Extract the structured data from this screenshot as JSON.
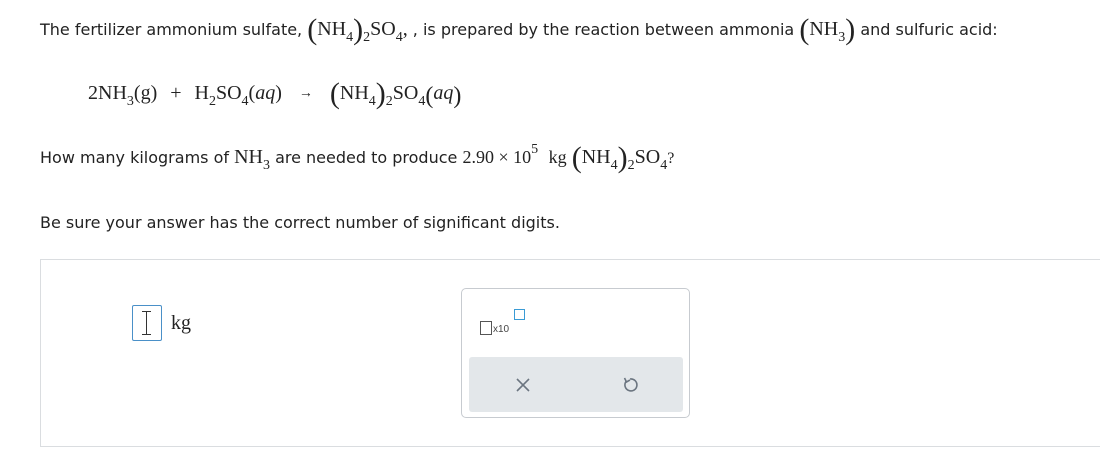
{
  "problem": {
    "intro_before": "The fertilizer ammonium sulfate,",
    "intro_middle": ", is prepared by the reaction between ammonia",
    "intro_after": "and sulfuric acid:",
    "question_before": "How many kilograms of",
    "question_middle": "are needed to produce",
    "mass_mantissa": "2.90",
    "times": "×",
    "mass_base": "10",
    "mass_exponent": "5",
    "mass_unit": "kg",
    "question_end": "?",
    "instruction": "Be sure your answer has the correct number of significant digits."
  },
  "formulas": {
    "nh4": "NH",
    "sub4": "4",
    "sub2": "2",
    "so4": "SO",
    "nh3": "NH",
    "sub3": "3",
    "h": "H",
    "comma": ",",
    "open_paren": "(",
    "close_paren": ")"
  },
  "equation": {
    "coef": "2",
    "g": "g",
    "aq": "aq",
    "plus": "+",
    "arrow": "→"
  },
  "answer": {
    "value": "",
    "unit": "kg"
  },
  "tools": {
    "x10_label": "x10",
    "clear_icon": "close-icon",
    "undo_icon": "undo-icon"
  },
  "colors": {
    "input_border": "#4a90c8",
    "exponent_box": "#3a9bd5",
    "action_bar": "#e3e7ea"
  }
}
